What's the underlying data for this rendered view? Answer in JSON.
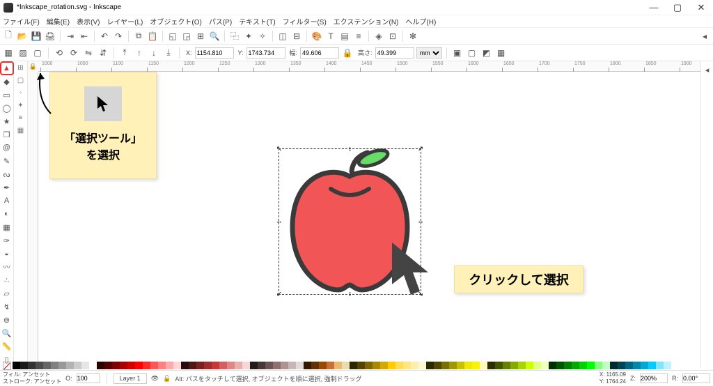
{
  "window": {
    "title": "*Inkscape_rotation.svg - Inkscape"
  },
  "menu": {
    "file": "ファイル(F)",
    "edit": "編集(E)",
    "view": "表示(V)",
    "layer": "レイヤー(L)",
    "object": "オブジェクト(O)",
    "path": "パス(P)",
    "text": "テキスト(T)",
    "filter": "フィルター(S)",
    "ext": "エクステンション(N)",
    "help": "ヘルプ(H)"
  },
  "prop": {
    "xlabel": "X:",
    "xval": "1154.810",
    "ylabel": "Y:",
    "yval": "1743.734",
    "wlabel": "幅:",
    "wval": "49.606",
    "hlabel": "高さ:",
    "hval": "49.399",
    "unit": "mm"
  },
  "callout1": {
    "line1": "「選択ツール」",
    "line2": "を選択"
  },
  "callout2": {
    "text": "クリックして選択"
  },
  "ruler_ticks": [
    1000,
    1050,
    1100,
    1150,
    1200,
    1250,
    1300,
    1350,
    1400,
    1450,
    1500,
    1550,
    1600,
    1650,
    1700,
    1750,
    1800,
    1850,
    1900
  ],
  "status": {
    "fill_label": "フィル:",
    "stroke_label": "ストローク:",
    "fill_val": "アンセット",
    "stroke_val": "アンセット",
    "opacity_lbl": "O:",
    "opacity": "100",
    "layer": "Layer 1",
    "hint": "Alt: パスをタッチして選択, オブジェクトを順に選択, 強制ドラッグ",
    "coord_xl": "X:",
    "coord_x": "1165.09",
    "coord_yl": "Y:",
    "coord_y": "1764.24",
    "zoom_lbl": "Z:",
    "zoom": "200%",
    "rot_lbl": "R:",
    "rot": "0.00°"
  },
  "palette": [
    "#000000",
    "#1a1a1a",
    "#333333",
    "#4d4d4d",
    "#666666",
    "#808080",
    "#999999",
    "#b3b3b3",
    "#cccccc",
    "#e6e6e6",
    "#ffffff",
    "#2f0000",
    "#550000",
    "#800000",
    "#aa0000",
    "#d40000",
    "#ff0000",
    "#ff2a2a",
    "#ff5555",
    "#ff8080",
    "#ffaaaa",
    "#ffd5d5",
    "#280b0b",
    "#501616",
    "#782121",
    "#a02c2c",
    "#c83737",
    "#d35f5f",
    "#de8787",
    "#e9afaf",
    "#f4d7d7",
    "#241c1c",
    "#483737",
    "#6c5353",
    "#916f6f",
    "#ac9393",
    "#c8b7b7",
    "#e3dbdb",
    "#321900",
    "#643200",
    "#964b00",
    "#c87137",
    "#e9b96e",
    "#e9ddaf",
    "#2f2500",
    "#554400",
    "#806600",
    "#aa8800",
    "#d4aa00",
    "#ffcc00",
    "#ffdd55",
    "#ffe680",
    "#ffeeaa",
    "#fff6d5",
    "#2c2800",
    "#504800",
    "#787000",
    "#a09800",
    "#c8c000",
    "#f0e800",
    "#f8f400",
    "#fdfabe",
    "#2a2f00",
    "#445500",
    "#668000",
    "#88aa00",
    "#aad400",
    "#ccff00",
    "#e3ff80",
    "#f1ffbf",
    "#002f00",
    "#005500",
    "#008000",
    "#00aa00",
    "#00d400",
    "#00ff00",
    "#80ff80",
    "#bfffbf",
    "#002a2f",
    "#004455",
    "#006680",
    "#0088aa",
    "#00aad4",
    "#00ccff",
    "#80e5ff",
    "#bff2ff"
  ]
}
